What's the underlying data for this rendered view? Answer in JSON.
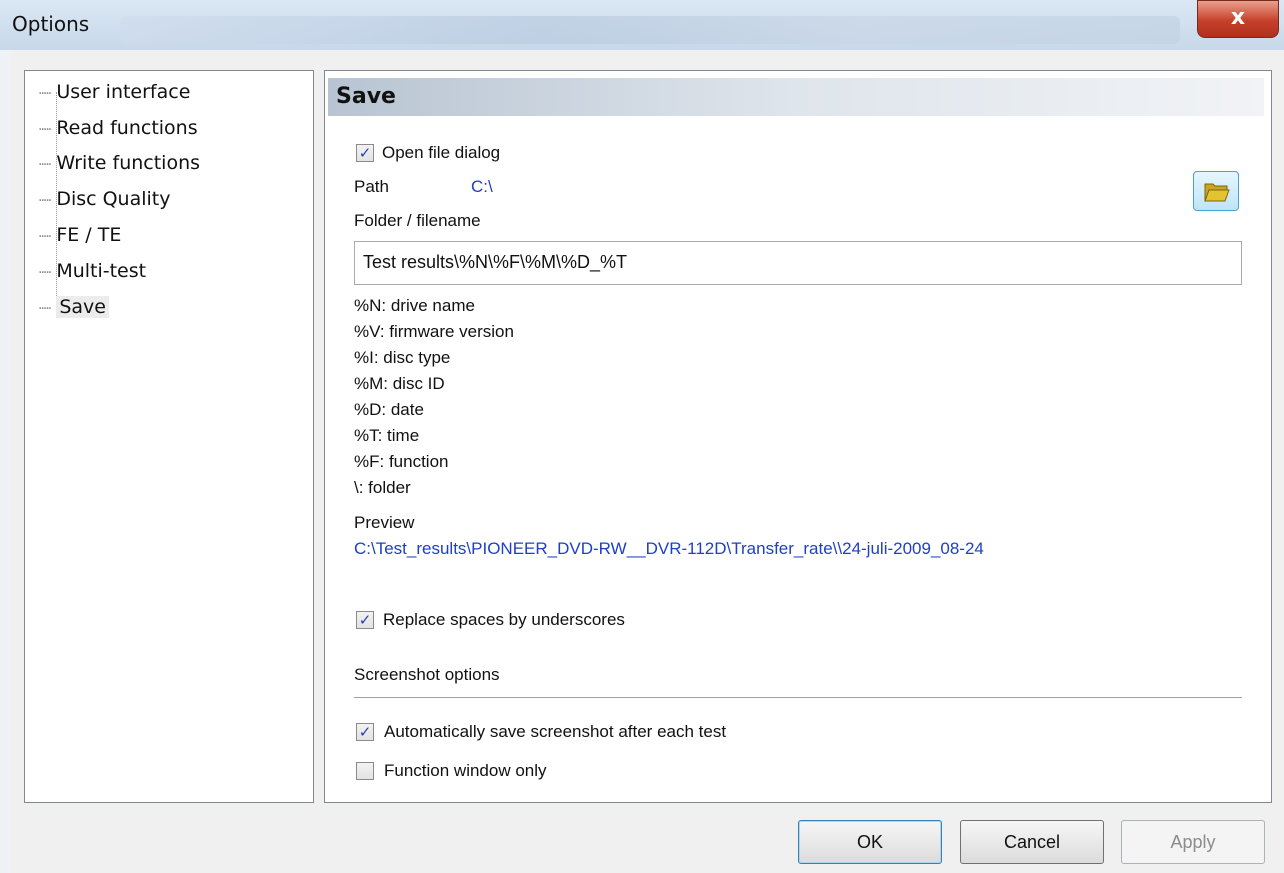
{
  "window": {
    "title": "Options",
    "close_glyph": "x"
  },
  "tree": {
    "items": [
      {
        "label": "User interface"
      },
      {
        "label": "Read functions"
      },
      {
        "label": "Write functions"
      },
      {
        "label": "Disc Quality"
      },
      {
        "label": "FE / TE"
      },
      {
        "label": "Multi-test"
      },
      {
        "label": "Save",
        "selected": true
      }
    ]
  },
  "panel": {
    "title": "Save",
    "open_file_dialog": {
      "label": "Open file dialog",
      "checked": true
    },
    "path_label": "Path",
    "path_value": "C:\\",
    "folder_label": "Folder / filename",
    "folder_value": "Test results\\%N\\%F\\%M\\%D_%T",
    "legend": [
      "%N: drive name",
      "%V: firmware version",
      "%I: disc type",
      "%M: disc ID",
      "%D: date",
      "%T: time",
      "%F: function",
      "\\: folder"
    ],
    "preview_label": "Preview",
    "preview_value": "C:\\Test_results\\PIONEER_DVD-RW__DVR-112D\\Transfer_rate\\\\24-juli-2009_08-24",
    "replace_spaces": {
      "label": "Replace spaces by underscores",
      "checked": true
    },
    "screenshot_section": "Screenshot options",
    "auto_save": {
      "label": "Automatically save screenshot after each test",
      "checked": true
    },
    "function_window": {
      "label": "Function window only",
      "checked": false
    }
  },
  "buttons": {
    "ok": "OK",
    "cancel": "Cancel",
    "apply": "Apply"
  },
  "icons": {
    "folder": "open-folder-icon",
    "checkmark": "✓"
  },
  "colors": {
    "link_blue": "#1f3fc4",
    "folder_yellow": "#e3c430"
  }
}
